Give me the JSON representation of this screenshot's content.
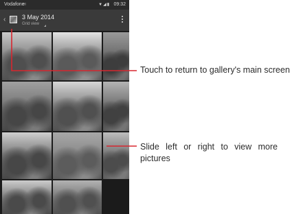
{
  "status_bar": {
    "carrier": "Vodafone",
    "time": "09:32"
  },
  "action_bar": {
    "title": "3 May 2014",
    "view_mode": "Grid view"
  },
  "callouts": [
    {
      "text": "Touch to return to gallery's main screen"
    },
    {
      "text": "Slide left or right to view more pictures"
    }
  ],
  "colors": {
    "callout_line": "#d8262f",
    "status_bar": "#2b2b2b",
    "action_bar": "#3a3a3a"
  },
  "icons": {
    "status": [
      "wifi-icon",
      "signal-icon",
      "battery-icon"
    ],
    "action_bar": [
      "back-chevron-icon",
      "album-thumbnail-icon",
      "overflow-menu-icon"
    ]
  },
  "photos": [
    {
      "name": "photo-1",
      "sky": "#c9c9c9",
      "mid": "#8a8a8a",
      "dark": "#4f4f4f"
    },
    {
      "name": "photo-2",
      "sky": "#e2e2e2",
      "mid": "#8f8f8f",
      "dark": "#5a5a5a"
    },
    {
      "name": "photo-3",
      "sky": "#9a9a9a",
      "mid": "#6f6f6f",
      "dark": "#3d3d3d"
    },
    {
      "name": "photo-4",
      "sky": "#a0a0a0",
      "mid": "#7a7a7a",
      "dark": "#464646"
    },
    {
      "name": "photo-5",
      "sky": "#d6d6d6",
      "mid": "#888888",
      "dark": "#505050"
    },
    {
      "name": "photo-6",
      "sky": "#b4b4b4",
      "mid": "#747474",
      "dark": "#414141"
    },
    {
      "name": "photo-7",
      "sky": "#cfcfcf",
      "mid": "#7e7e7e",
      "dark": "#474747"
    },
    {
      "name": "photo-8",
      "sky": "#a8a8a8",
      "mid": "#8a8a8a",
      "dark": "#5c5c5c"
    },
    {
      "name": "photo-9",
      "sky": "#bdbdbd",
      "mid": "#7a7a7a",
      "dark": "#4c4c4c"
    },
    {
      "name": "photo-10",
      "sky": "#cccccc",
      "mid": "#848484",
      "dark": "#4a4a4a"
    },
    {
      "name": "photo-11",
      "sky": "#b2b2b2",
      "mid": "#7e7e7e",
      "dark": "#505050"
    }
  ]
}
